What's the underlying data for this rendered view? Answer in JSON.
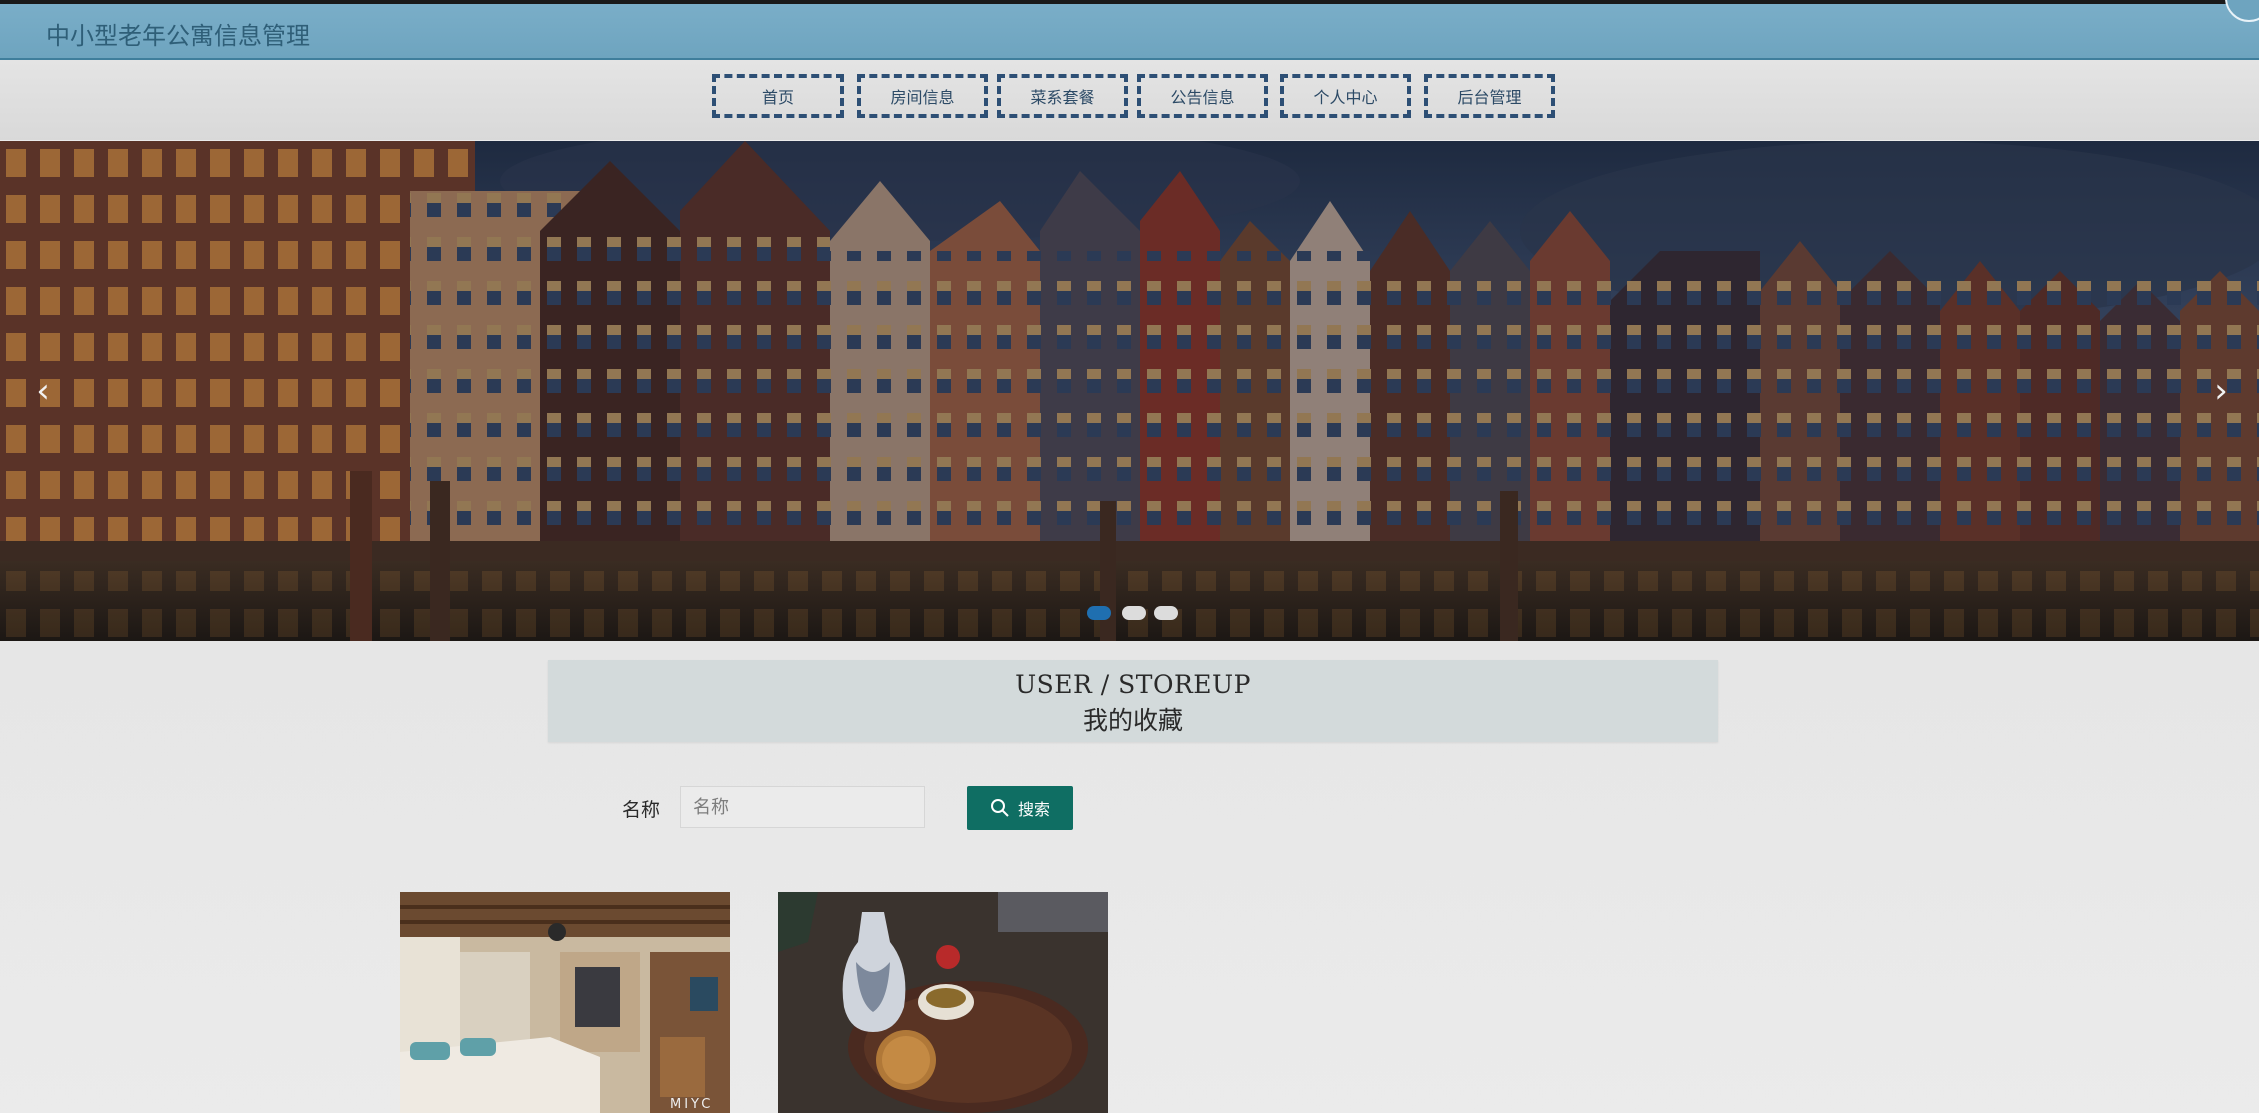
{
  "header": {
    "title": "中小型老年公寓信息管理"
  },
  "nav": {
    "items": [
      {
        "label": "首页"
      },
      {
        "label": "房间信息"
      },
      {
        "label": "菜系套餐"
      },
      {
        "label": "公告信息"
      },
      {
        "label": "个人中心"
      },
      {
        "label": "后台管理"
      }
    ]
  },
  "banner": {
    "prev_icon": "chevron-left-icon",
    "next_icon": "chevron-right-icon",
    "dots": 3,
    "active_dot": 0
  },
  "section": {
    "title_en": "USER / STOREUP",
    "title_cn": "我的收藏"
  },
  "search": {
    "label": "名称",
    "placeholder": "名称",
    "button_label": "搜索",
    "button_icon": "search-icon"
  },
  "cards": [
    {
      "image": "bedroom-photo",
      "watermark": "MIYC"
    },
    {
      "image": "tea-set-photo"
    }
  ],
  "colors": {
    "header_bg": "#6ea4bf",
    "nav_border": "#2d4f75",
    "search_button": "#0f6e63",
    "active_dot": "#1f6fb0",
    "title_box": "#d3dadb"
  }
}
